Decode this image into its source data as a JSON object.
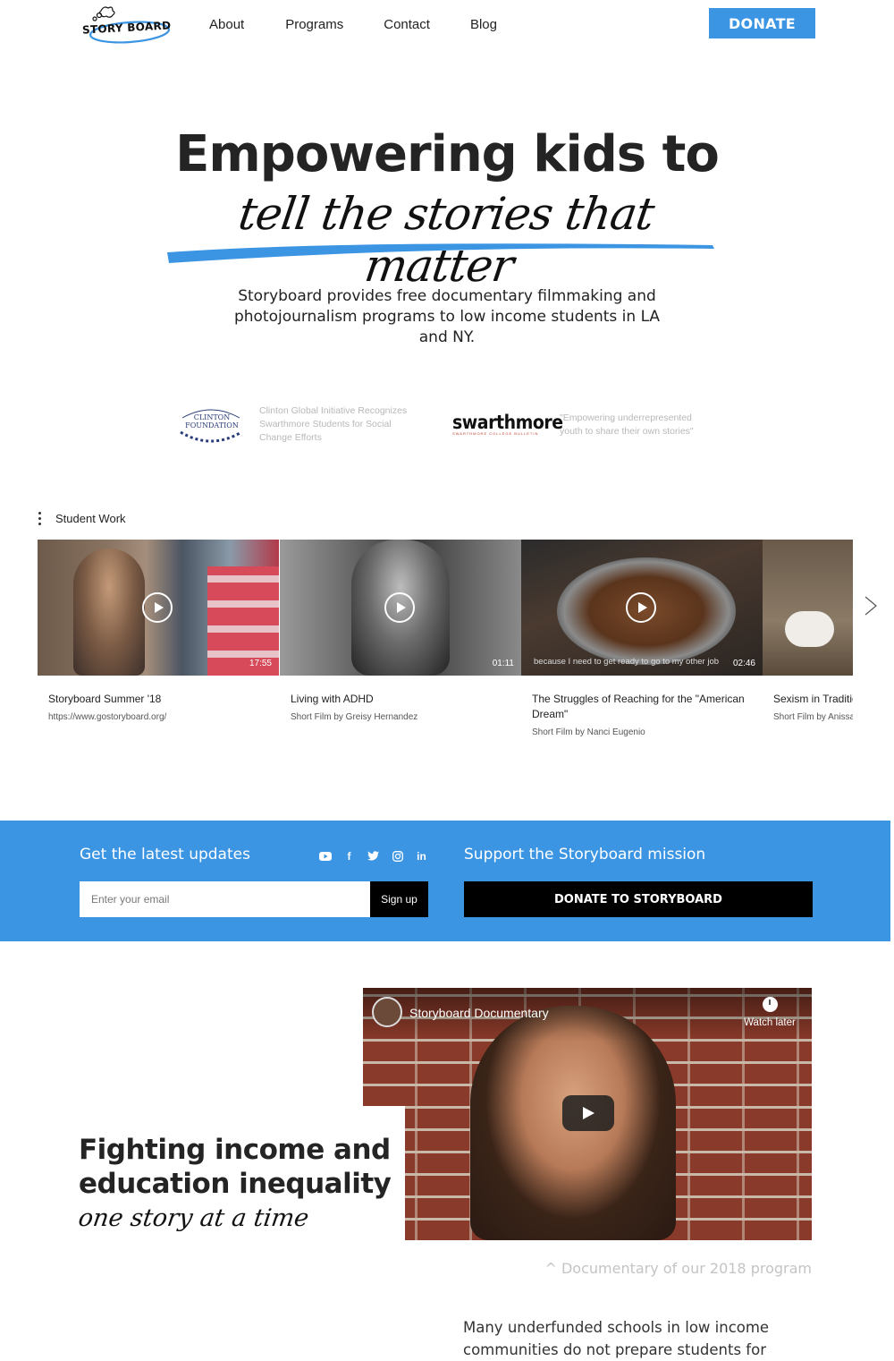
{
  "header": {
    "logo_text": "STORY BOARD",
    "nav": [
      "About",
      "Programs",
      "Contact",
      "Blog"
    ],
    "donate_label": "DONATE",
    "accent_color": "#3b95e3"
  },
  "hero": {
    "title": "Empowering kids to",
    "script": "tell the stories that matter",
    "description": "Storyboard provides free documentary filmmaking and photojournalism programs to low income students in LA and NY."
  },
  "press": {
    "clinton_logo_line1": "CLINTON",
    "clinton_logo_line2": "FOUNDATION",
    "clinton_text": "Clinton Global Initiative Recognizes Swarthmore Students for Social Change Efforts",
    "swarthmore_logo": "swarthmore",
    "swarthmore_logo_sub": "SWARTHMORE COLLEGE BULLETIN",
    "swarthmore_text": "\"Empowering underrepresented youth to share their own stories\""
  },
  "student_work": {
    "title": "Student Work",
    "videos": [
      {
        "title": "Storyboard Summer '18",
        "subtitle": "https://www.gostoryboard.org/",
        "duration": "17:55",
        "caption": ""
      },
      {
        "title": "Living with ADHD",
        "subtitle": "Short Film by Greisy Hernandez",
        "duration": "01:11",
        "caption": ""
      },
      {
        "title": "The Struggles of Reaching for the \"American Dream\"",
        "subtitle": "Short Film by Nanci Eugenio",
        "duration": "02:46",
        "caption": "because I need to get ready to go to my other job"
      },
      {
        "title": "Sexism in Traditio",
        "subtitle": "Short Film by Anissa",
        "duration": "",
        "caption": ""
      }
    ]
  },
  "newsletter": {
    "label": "Get the latest updates",
    "socials": [
      "youtube-icon",
      "facebook-icon",
      "twitter-icon",
      "instagram-icon",
      "linkedin-icon"
    ],
    "email_placeholder": "Enter your email",
    "signup_label": "Sign up",
    "support_label": "Support the Storyboard mission",
    "donate_label": "DONATE TO STORYBOARD"
  },
  "video": {
    "title": "Storyboard Documentary",
    "watch_later": "Watch later"
  },
  "mission": {
    "title": "Fighting income and education inequality",
    "script": "one story at a time",
    "doc_caption": "^ Documentary of our 2018 program",
    "body": "Many underfunded schools in low income communities do not prepare students for"
  }
}
